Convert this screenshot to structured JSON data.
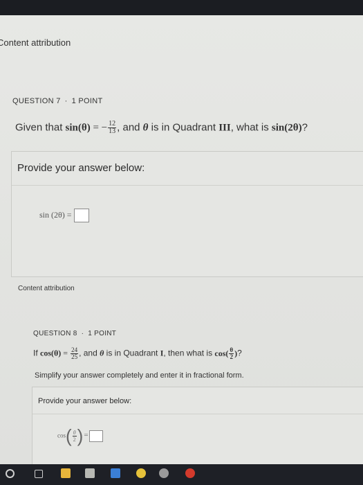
{
  "attribution_top": "Content attribution",
  "q7": {
    "number": "QUESTION 7",
    "points": "1 POINT",
    "t1": "Given that ",
    "sin_theta": "sin(θ)",
    "eq_minus": " = −",
    "frac_num": "12",
    "frac_den": "13",
    "t2": ", and ",
    "theta": "θ",
    "t3": " is in Quadrant ",
    "quadrant": "III",
    "t4": ", what is ",
    "sin_2theta": "sin(2θ)",
    "t5": "?",
    "provide": "Provide your answer below:",
    "answer_lhs": "sin (2θ) ="
  },
  "attribution_mid": "Content attribution",
  "q8": {
    "number": "QUESTION 8",
    "points": "1 POINT",
    "t1": "If ",
    "cos_theta": "cos(θ)",
    "eq": " = ",
    "frac_num": "24",
    "frac_den": "25",
    "t2": ", and ",
    "theta": "θ",
    "t3": " is in Quadrant ",
    "quadrant": "I",
    "t4": ", then what is ",
    "cos_fn": "cos",
    "half_num": "θ",
    "half_den": "2",
    "t5": "?",
    "simplify": "Simplify your answer completely and enter it in fractional form.",
    "provide": "Provide your answer below:",
    "answer_fn": "cos",
    "answer_eq": "="
  },
  "colors": {
    "screen_bg": "#e3e4e1",
    "bezel": "#1b1d22",
    "text": "#2b2b2b"
  }
}
